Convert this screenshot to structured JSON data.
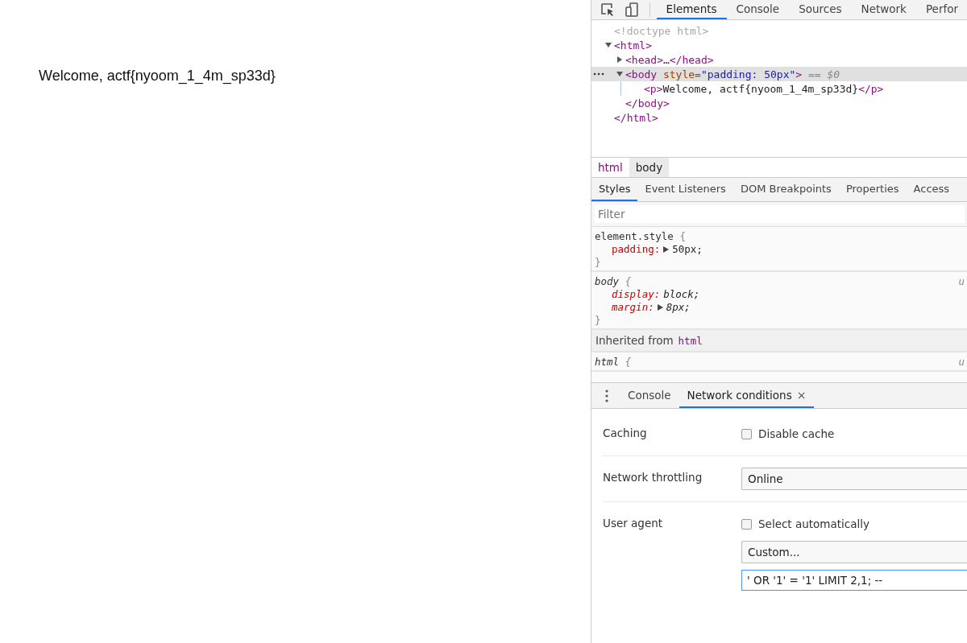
{
  "page": {
    "text": "Welcome, actf{nyoom_1_4m_sp33d}"
  },
  "devtools": {
    "tabs": [
      {
        "label": "Elements",
        "selected": true
      },
      {
        "label": "Console",
        "selected": false
      },
      {
        "label": "Sources",
        "selected": false
      },
      {
        "label": "Network",
        "selected": false
      },
      {
        "label": "Perfor",
        "selected": false
      }
    ],
    "dom": [
      {
        "selected": false,
        "segments": [
          {
            "kind": "comment",
            "text": "<!doctype html>"
          }
        ]
      },
      {
        "selected": false,
        "expanded": true,
        "segments": [
          {
            "kind": "tag",
            "text": "<html>"
          }
        ],
        "closing": "</html>",
        "children": [
          {
            "selected": false,
            "expanded": false,
            "segments": [
              {
                "kind": "tag",
                "text": "<head>"
              },
              {
                "kind": "text",
                "text": "…"
              },
              {
                "kind": "tag",
                "text": "</head>"
              }
            ]
          },
          {
            "selected": true,
            "expanded": true,
            "segments": [
              {
                "kind": "tag",
                "text": "<body"
              },
              {
                "kind": "attr",
                "text": "style"
              },
              {
                "kind": "punct",
                "text": "="
              },
              {
                "kind": "value",
                "text": "\"padding: 50px\""
              },
              {
                "kind": "tag",
                "text": ">"
              },
              {
                "kind": "ref",
                "text": "== $0"
              }
            ],
            "closing": "</body>",
            "children": [
              {
                "selected": false,
                "segments": [
                  {
                    "kind": "tag",
                    "text": "<p>"
                  },
                  {
                    "kind": "text",
                    "text": "Welcome, actf{nyoom_1_4m_sp33d}"
                  },
                  {
                    "kind": "tag",
                    "text": "</p>"
                  }
                ]
              }
            ]
          }
        ]
      }
    ],
    "breadcrumbs": [
      {
        "label": "html",
        "kind": "tag",
        "selected": false
      },
      {
        "label": "body",
        "kind": "tag",
        "selected": true
      }
    ],
    "style_tabs": [
      {
        "label": "Styles",
        "selected": true
      },
      {
        "label": "Event Listeners",
        "selected": false
      },
      {
        "label": "DOM Breakpoints",
        "selected": false
      },
      {
        "label": "Properties",
        "selected": false
      },
      {
        "label": "Access",
        "selected": false
      }
    ],
    "filter": {
      "placeholder": "Filter"
    },
    "rules": [
      {
        "kind": "rule",
        "selector": "element.style",
        "italic": false,
        "open": "{",
        "close": "}",
        "declarations": [
          {
            "name": "padding:",
            "value": "50px;",
            "expandable": true
          }
        ]
      },
      {
        "kind": "rule",
        "selector": "body",
        "italic": true,
        "source": "u",
        "open": "{",
        "close": "}",
        "declarations": [
          {
            "name": "display:",
            "value": "block;",
            "expandable": false
          },
          {
            "name": "margin:",
            "value": "8px;",
            "expandable": true
          }
        ]
      },
      {
        "kind": "inherited",
        "label": "Inherited from",
        "tag": "html"
      },
      {
        "kind": "rule",
        "selector": "html",
        "italic": true,
        "source": "u",
        "open": "{"
      }
    ],
    "drawer_tabs": [
      {
        "label": "Console",
        "selected": false,
        "closable": false
      },
      {
        "label": "Network conditions",
        "selected": true,
        "closable": true,
        "close": "×"
      }
    ],
    "network_conditions": [
      {
        "label": "Caching",
        "controls": [
          {
            "kind": "checkbox",
            "label": "Disable cache",
            "checked": false
          }
        ]
      },
      {
        "label": "Network throttling",
        "controls": [
          {
            "kind": "select",
            "value": "Online"
          }
        ]
      },
      {
        "label": "User agent",
        "controls": [
          {
            "kind": "checkbox",
            "label": "Select automatically",
            "checked": false
          },
          {
            "kind": "select",
            "value": "Custom..."
          },
          {
            "kind": "input",
            "value": "' OR '1' = '1' LIMIT 2,1; --",
            "focused": true
          }
        ]
      }
    ]
  }
}
